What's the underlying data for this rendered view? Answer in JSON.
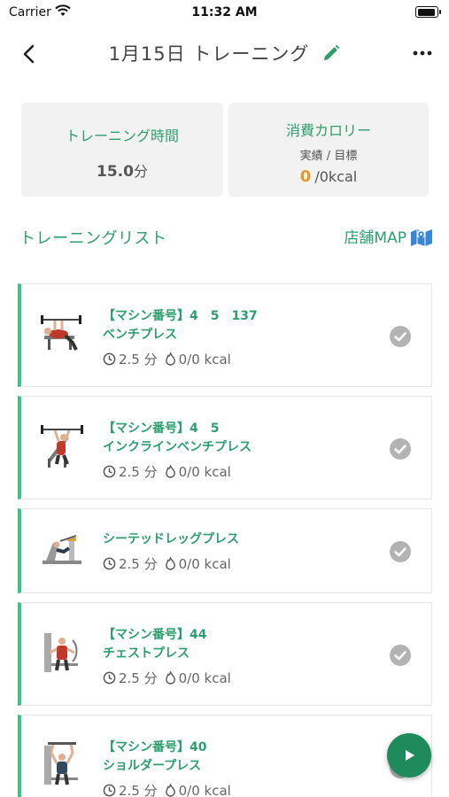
{
  "status_bar": {
    "carrier": "Carrier",
    "time": "11:32 AM"
  },
  "nav": {
    "title": "1月15日 トレーニング",
    "back_icon": "chevron-left-icon",
    "edit_icon": "pencil-icon",
    "more_icon": "ellipsis-icon"
  },
  "stats": {
    "training_time": {
      "label": "トレーニング時間",
      "value": "15.0",
      "unit": "分"
    },
    "calories": {
      "label": "消費カロリー",
      "sublabel": "実績 / 目標",
      "actual": "0",
      "target": "/0kcal"
    }
  },
  "list_header": {
    "title": "トレーニングリスト",
    "map_label": "店舗MAP",
    "map_icon": "map-icon"
  },
  "exercises": [
    {
      "machine": "【マシン番号】4　5　137",
      "name": "ベンチプレス",
      "time": "2.5 分",
      "kcal": "0/0 kcal",
      "completed": true
    },
    {
      "machine": "【マシン番号】4　5",
      "name": "インクラインベンチプレス",
      "time": "2.5 分",
      "kcal": "0/0 kcal",
      "completed": true
    },
    {
      "machine": "",
      "name": "シーテッドレッグプレス",
      "time": "2.5 分",
      "kcal": "0/0 kcal",
      "completed": true
    },
    {
      "machine": "【マシン番号】44",
      "name": "チェストプレス",
      "time": "2.5 分",
      "kcal": "0/0 kcal",
      "completed": true
    },
    {
      "machine": "【マシン番号】40",
      "name": "ショルダープレス",
      "time": "2.5 分",
      "kcal": "0/0 kcal",
      "completed": true
    }
  ],
  "colors": {
    "accent": "#2e9e6f",
    "accent_bar": "#3ac48b",
    "calorie_actual": "#e59a26",
    "fab": "#1f8a5b",
    "check": "#b3b3b3"
  },
  "fab": {
    "icon": "play-icon"
  }
}
